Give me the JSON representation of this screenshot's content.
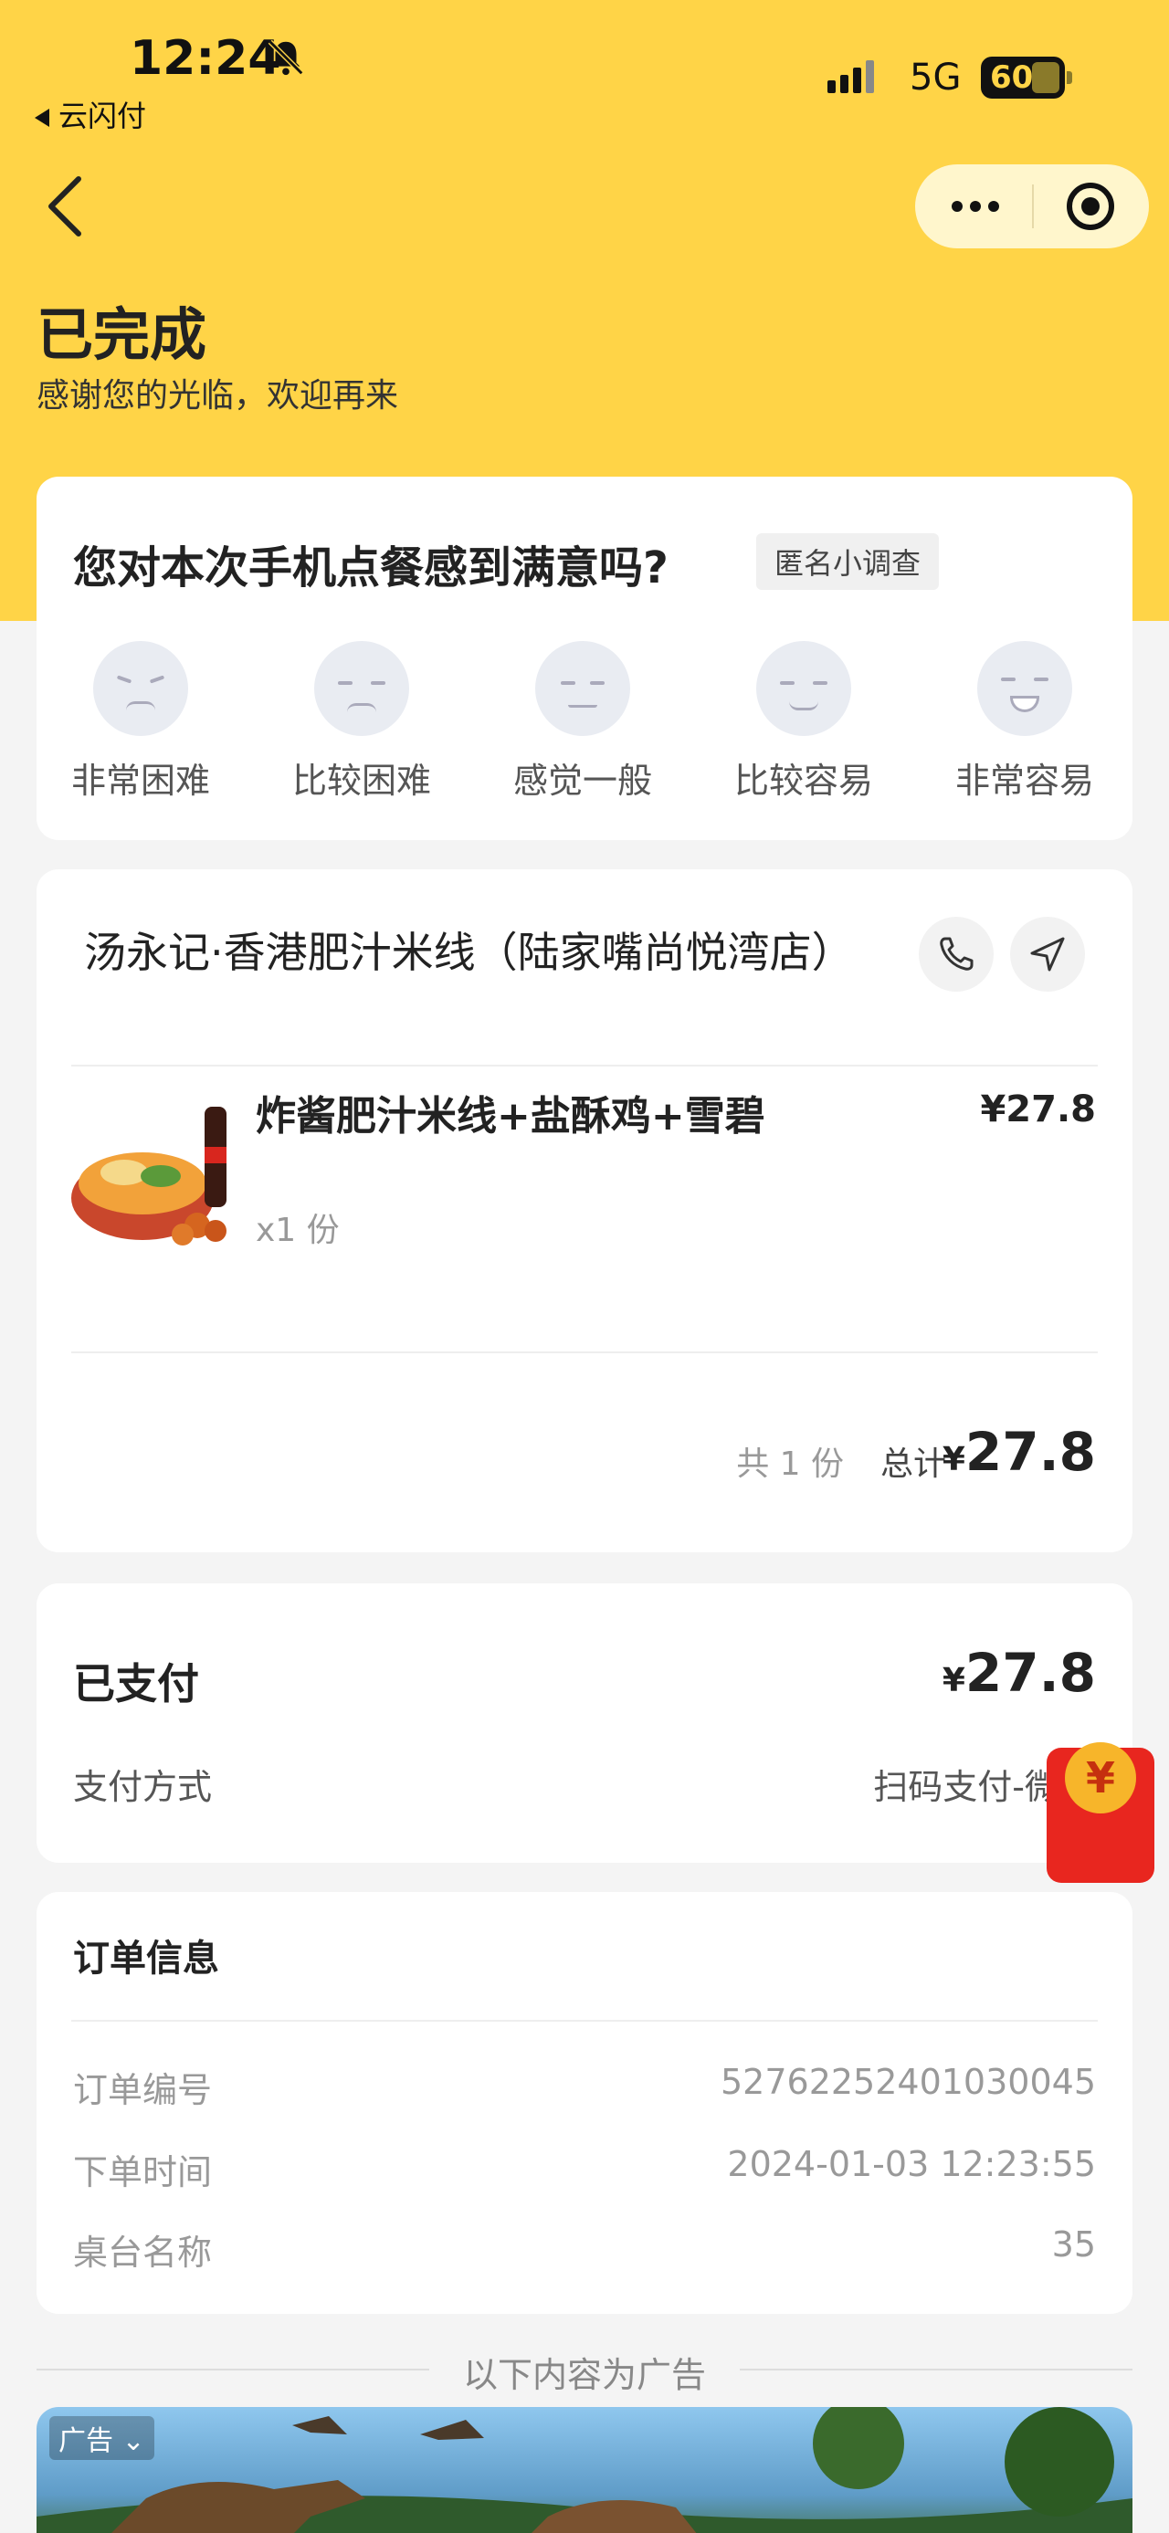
{
  "status_bar": {
    "time": "12:24",
    "back_app": "云闪付",
    "network": "5G",
    "battery": "60"
  },
  "header": {
    "title": "已完成",
    "subtitle": "感谢您的光临，欢迎再来"
  },
  "survey": {
    "question": "您对本次手机点餐感到满意吗?",
    "tag": "匿名小调查",
    "options": [
      "非常困难",
      "比较困难",
      "感觉一般",
      "比较容易",
      "非常容易"
    ]
  },
  "order": {
    "store_name": "汤永记·香港肥汁米线（陆家嘴尚悦湾店）",
    "dish_name": "炸酱肥汁米线+盐酥鸡+雪碧",
    "dish_price": "¥27.8",
    "dish_qty": "x1 份",
    "count_text": "共 1 份",
    "total_label": "总计",
    "currency": "¥",
    "total_value": "27.8"
  },
  "payment": {
    "paid_label": "已支付",
    "currency": "¥",
    "paid_value": "27.8",
    "method_label": "支付方式",
    "method_value": "扫码支付-微"
  },
  "order_info": {
    "title": "订单信息",
    "rows": [
      {
        "label": "订单编号",
        "value": "52762252401030045"
      },
      {
        "label": "下单时间",
        "value": "2024-01-03 12:23:55"
      },
      {
        "label": "桌台名称",
        "value": "35"
      }
    ]
  },
  "ad": {
    "divider_text": "以下内容为广告",
    "tag": "广告"
  },
  "red_packet": {
    "symbol": "¥"
  },
  "colors": {
    "brand_yellow": "#ffd447",
    "red_packet": "#e8261f"
  }
}
